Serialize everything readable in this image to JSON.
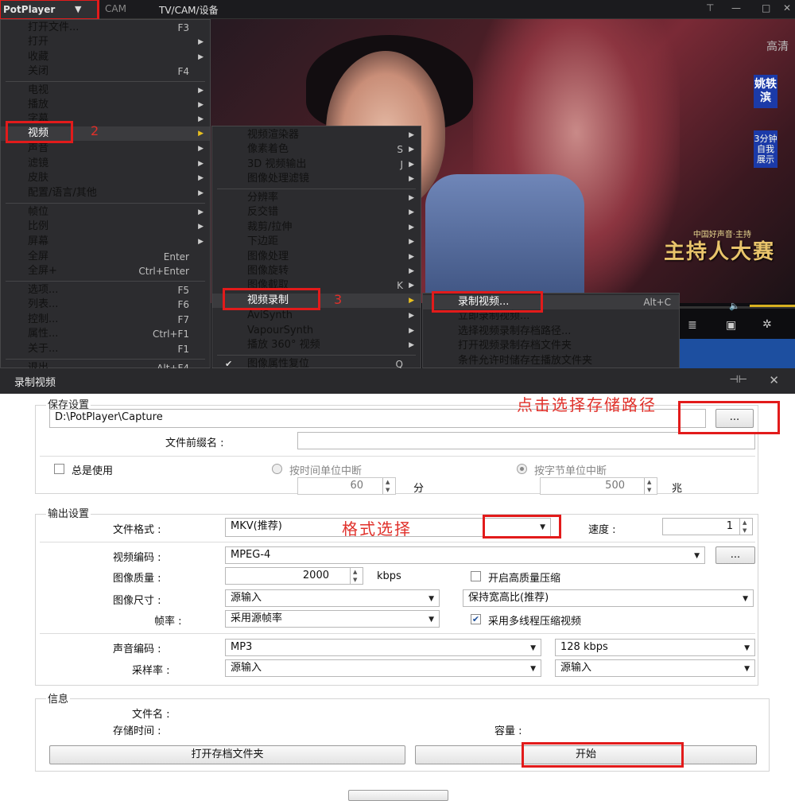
{
  "titlebar": {
    "app_button": "PotPlayer",
    "cam": "CAM",
    "title": "TV/CAM/设备"
  },
  "video": {
    "channel_watermark": "高清",
    "badge_name": "姚轶滨",
    "badge_sub": "3分钟自我展示",
    "logo_top": "中国好声音·主持",
    "logo": "主持人大赛"
  },
  "menu_main": {
    "items": [
      {
        "label": "打开文件...",
        "shortcut": "F3",
        "arrow": false
      },
      {
        "label": "打开",
        "shortcut": "",
        "arrow": true
      },
      {
        "label": "收藏",
        "shortcut": "",
        "arrow": true
      },
      {
        "label": "关闭",
        "shortcut": "F4",
        "arrow": false
      },
      {
        "label": "电视",
        "shortcut": "",
        "arrow": true
      },
      {
        "label": "播放",
        "shortcut": "",
        "arrow": true
      },
      {
        "label": "字幕",
        "shortcut": "",
        "arrow": true
      },
      {
        "label": "视频",
        "shortcut": "",
        "arrow": true
      },
      {
        "label": "声音",
        "shortcut": "",
        "arrow": true
      },
      {
        "label": "滤镜",
        "shortcut": "",
        "arrow": true
      },
      {
        "label": "皮肤",
        "shortcut": "",
        "arrow": true
      },
      {
        "label": "配置/语言/其他",
        "shortcut": "",
        "arrow": true
      },
      {
        "label": "帧位",
        "shortcut": "",
        "arrow": true
      },
      {
        "label": "比例",
        "shortcut": "",
        "arrow": true
      },
      {
        "label": "屏幕",
        "shortcut": "",
        "arrow": true
      },
      {
        "label": "全屏",
        "shortcut": "Enter",
        "arrow": false
      },
      {
        "label": "全屏+",
        "shortcut": "Ctrl+Enter",
        "arrow": false
      },
      {
        "label": "选项...",
        "shortcut": "F5",
        "arrow": false
      },
      {
        "label": "列表...",
        "shortcut": "F6",
        "arrow": false
      },
      {
        "label": "控制...",
        "shortcut": "F7",
        "arrow": false
      },
      {
        "label": "属性...",
        "shortcut": "Ctrl+F1",
        "arrow": false
      },
      {
        "label": "关于...",
        "shortcut": "F1",
        "arrow": false
      },
      {
        "label": "退出",
        "shortcut": "Alt+F4",
        "arrow": false
      }
    ]
  },
  "menu_video": {
    "items": [
      {
        "label": "视频渲染器",
        "shortcut": "",
        "arrow": true
      },
      {
        "label": "像素着色",
        "shortcut": "S",
        "arrow": true
      },
      {
        "label": "3D 视频输出",
        "shortcut": "J",
        "arrow": true
      },
      {
        "label": "图像处理滤镜",
        "shortcut": "",
        "arrow": true
      },
      {
        "label": "分辨率",
        "shortcut": "",
        "arrow": true
      },
      {
        "label": "反交错",
        "shortcut": "",
        "arrow": true
      },
      {
        "label": "裁剪/拉伸",
        "shortcut": "",
        "arrow": true
      },
      {
        "label": "下边距",
        "shortcut": "",
        "arrow": true
      },
      {
        "label": "图像处理",
        "shortcut": "",
        "arrow": true
      },
      {
        "label": "图像旋转",
        "shortcut": "",
        "arrow": true
      },
      {
        "label": "图像截取",
        "shortcut": "K",
        "arrow": true
      },
      {
        "label": "视频录制",
        "shortcut": "",
        "arrow": true
      },
      {
        "label": "AviSynth",
        "shortcut": "",
        "arrow": true
      },
      {
        "label": "VapourSynth",
        "shortcut": "",
        "arrow": true
      },
      {
        "label": "播放 360° 视频",
        "shortcut": "",
        "arrow": true
      },
      {
        "label": "图像属性复位",
        "shortcut": "Q",
        "arrow": false
      }
    ]
  },
  "menu_record": {
    "items": [
      {
        "label": "录制视频...",
        "shortcut": "Alt+C"
      },
      {
        "label": "立即录制视频...",
        "shortcut": ""
      },
      {
        "label": "选择视频录制存档路径...",
        "shortcut": ""
      },
      {
        "label": "打开视频录制存档文件夹",
        "shortcut": ""
      },
      {
        "label": "条件允许时储存在播放文件夹",
        "shortcut": ""
      }
    ]
  },
  "annotations": {
    "step2": "2",
    "step3": "3",
    "path_hint": "点击选择存储路径",
    "format_hint": "格式选择"
  },
  "dialog": {
    "title": "录制视频",
    "save": {
      "group": "保存设置",
      "path": "D:\\PotPlayer\\Capture",
      "browse": "...",
      "prefix_label": "文件前缀名 :",
      "prefix_value": "",
      "always_use": "总是使用",
      "split_time": "按时间单位中断",
      "split_size": "按字节单位中断",
      "time_value": "60",
      "time_unit": "分",
      "size_value": "500",
      "size_unit": "兆"
    },
    "output": {
      "group": "输出设置",
      "format_label": "文件格式 :",
      "format_value": "MKV(推荐)",
      "speed_label": "速度 :",
      "speed_value": "1",
      "vcodec_label": "视频编码 :",
      "vcodec_value": "MPEG-4",
      "vcodec_btn": "...",
      "quality_label": "图像质量 :",
      "quality_value": "2000",
      "quality_unit": "kbps",
      "hq_compress": "开启高质量压缩",
      "size_label": "图像尺寸 :",
      "size_value": "源输入",
      "aspect_value": "保持宽高比(推荐)",
      "fps_label": "帧率 :",
      "fps_value": "采用源帧率",
      "multithread": "采用多线程压缩视频",
      "acodec_label": "声音编码 :",
      "acodec_value": "MP3",
      "abitrate_value": "128 kbps",
      "samplerate_label": "采样率 :",
      "samplerate_value": "源输入",
      "channels_value": "源输入"
    },
    "info": {
      "group": "信息",
      "filename_label": "文件名 :",
      "duration_label": "存储时间 :",
      "capacity_label": "容量 :",
      "open_folder": "打开存档文件夹",
      "start": "开始"
    }
  }
}
